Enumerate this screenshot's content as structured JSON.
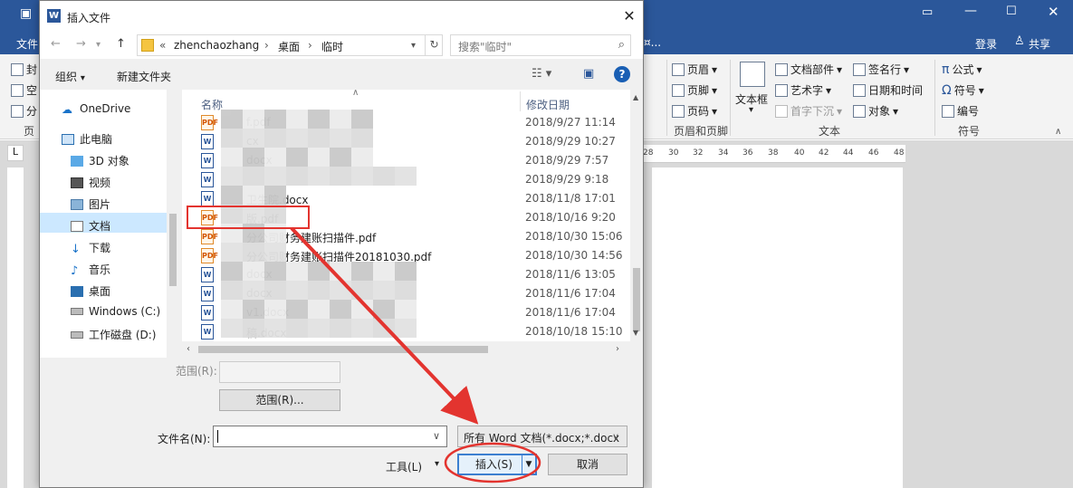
{
  "word": {
    "tab_file": "文件",
    "title_suffix": "¤...",
    "login": "登录",
    "share": "共享",
    "left_items": [
      "封",
      "空",
      "分"
    ],
    "left_group": "页",
    "ribbon": {
      "header": "页眉",
      "footer": "页脚",
      "page_number": "页码",
      "textbox": "文本框",
      "doc_parts": "文档部件",
      "wordart": "艺术字",
      "dropcap": "首字下沉",
      "signature": "签名行",
      "datetime": "日期和时间",
      "object": "对象",
      "equation": "公式",
      "symbol": "符号",
      "numbering": "编号",
      "groups": {
        "header_footer": "页眉和页脚",
        "text": "文本",
        "symbols": "符号"
      }
    },
    "ruler_ticks": [
      "28",
      "30",
      "32",
      "34",
      "36",
      "38",
      "40",
      "42",
      "44",
      "46",
      "48"
    ]
  },
  "dialog": {
    "title": "插入文件",
    "breadcrumb": [
      "«",
      "zhenchaozhang",
      "›",
      "桌面",
      "›",
      "临时"
    ],
    "search_placeholder": "搜索\"临时\"",
    "organize": "组织",
    "new_folder": "新建文件夹",
    "tree": [
      "OneDrive",
      "此电脑",
      "3D 对象",
      "视频",
      "图片",
      "文档",
      "下载",
      "音乐",
      "桌面",
      "Windows (C:)",
      "工作磁盘 (D:)"
    ],
    "columns": {
      "name": "名称",
      "date": "修改日期"
    },
    "files": [
      {
        "type": "pdf",
        "name": "f.pdf",
        "date": "2018/9/27 11:14"
      },
      {
        "type": "docx",
        "name": "cx",
        "date": "2018/9/29 10:27"
      },
      {
        "type": "docx",
        "name": "docx",
        "date": "2018/9/29 7:57"
      },
      {
        "type": "docx",
        "name": "",
        "date": "2018/9/29 9:18"
      },
      {
        "type": "docx",
        "name": "卫生院.docx",
        "date": "2018/11/8 17:01"
      },
      {
        "type": "pdf",
        "name": "版.pdf",
        "date": "2018/10/16 9:20"
      },
      {
        "type": "pdf",
        "name": "分公司财务建账扫描件.pdf",
        "date": "2018/10/30 15:06"
      },
      {
        "type": "pdf",
        "name": "分公司财务建账扫描件20181030.pdf",
        "date": "2018/10/30 14:56"
      },
      {
        "type": "docx",
        "name": "docx",
        "date": "2018/11/6 13:05"
      },
      {
        "type": "docx",
        "name": "docx",
        "date": "2018/11/6 17:04"
      },
      {
        "type": "docx",
        "name": "v1.docx",
        "date": "2018/11/6 17:04"
      },
      {
        "type": "docx",
        "name": "稿.docx",
        "date": "2018/10/18 15:10"
      }
    ],
    "range_label": "范围(R):",
    "range_button": "范围(R)...",
    "filename_label": "文件名(N):",
    "filename_value": "",
    "filter": "所有 Word 文档(*.docx;*.docx",
    "tools": "工具(L)",
    "insert": "插入(S)",
    "cancel": "取消"
  },
  "annotation_color": "#e3342f"
}
